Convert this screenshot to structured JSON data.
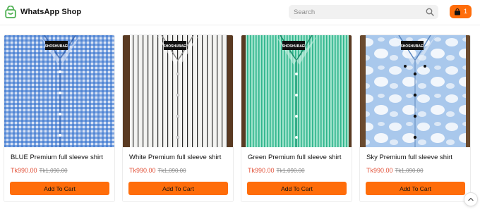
{
  "header": {
    "brand": "WhatsApp Shop",
    "search_placeholder": "Search",
    "cart_count": "1"
  },
  "colors": {
    "accent": "#ff6d0a",
    "price": "#e2523a",
    "brand_icon": "#4caf50"
  },
  "icons": {
    "logo": "shopping-bag-icon",
    "search": "search-icon",
    "cart": "shopping-bag-icon",
    "scroll_top": "chevron-up-icon"
  },
  "products": [
    {
      "title": "BLUE Premium full sleeve shirt",
      "price": "Tk990.00",
      "old_price": "Tk1,090.00",
      "button": "Add To Cart",
      "tag": "SHOSHUBAEI"
    },
    {
      "title": "White Premium full sleeve shirt",
      "price": "Tk990.00",
      "old_price": "Tk1,090.00",
      "button": "Add To Cart",
      "tag": "SHOSHUBAEI"
    },
    {
      "title": "Green Premium full sleeve shirt",
      "price": "Tk990.00",
      "old_price": "Tk1,090.00",
      "button": "Add To Cart",
      "tag": "SHOSHUBAEI"
    },
    {
      "title": "Sky Premium full sleeve shirt",
      "price": "Tk990.00",
      "old_price": "Tk1,090.00",
      "button": "Add To Cart",
      "tag": "SHOSHUBAEI"
    }
  ]
}
